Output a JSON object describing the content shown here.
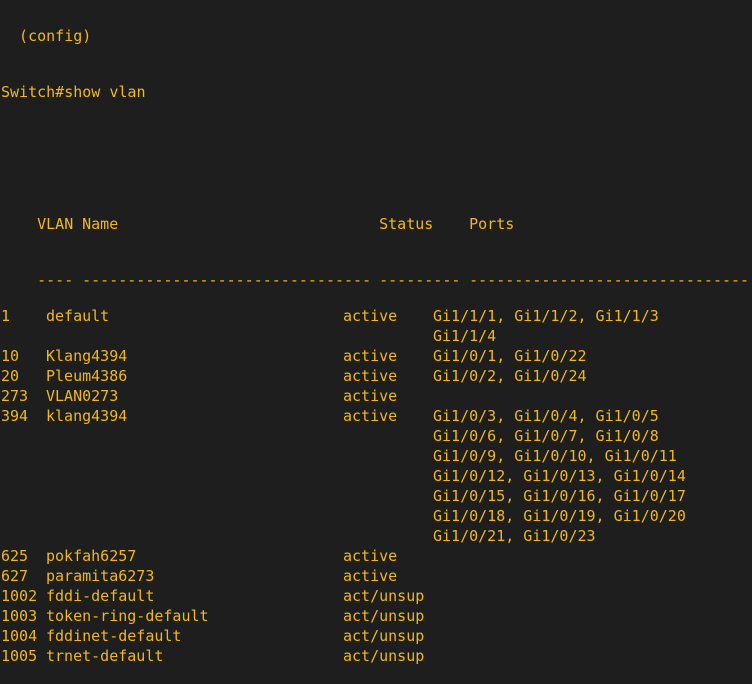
{
  "terminal": {
    "partial_line": "  (config)",
    "command_prompt": "Switch#show vlan"
  },
  "vlan_table": {
    "headers": {
      "vlan": "VLAN",
      "name": "Name",
      "status": "Status",
      "ports": "Ports"
    },
    "separators": {
      "vlan": "----",
      "name": "--------------------------------",
      "status": "---------",
      "ports": "-------------------------------"
    },
    "rows": [
      {
        "vlan": "1",
        "name": "default",
        "status": "active",
        "ports": "Gi1/1/1, Gi1/1/2, Gi1/1/3"
      },
      {
        "vlan": "",
        "name": "",
        "status": "",
        "ports": "Gi1/1/4"
      },
      {
        "vlan": "10",
        "name": "Klang4394",
        "status": "active",
        "ports": "Gi1/0/1, Gi1/0/22"
      },
      {
        "vlan": "20",
        "name": "Pleum4386",
        "status": "active",
        "ports": "Gi1/0/2, Gi1/0/24"
      },
      {
        "vlan": "273",
        "name": "VLAN0273",
        "status": "active",
        "ports": ""
      },
      {
        "vlan": "394",
        "name": "klang4394",
        "status": "active",
        "ports": "Gi1/0/3, Gi1/0/4, Gi1/0/5"
      },
      {
        "vlan": "",
        "name": "",
        "status": "",
        "ports": "Gi1/0/6, Gi1/0/7, Gi1/0/8"
      },
      {
        "vlan": "",
        "name": "",
        "status": "",
        "ports": "Gi1/0/9, Gi1/0/10, Gi1/0/11"
      },
      {
        "vlan": "",
        "name": "",
        "status": "",
        "ports": "Gi1/0/12, Gi1/0/13, Gi1/0/14"
      },
      {
        "vlan": "",
        "name": "",
        "status": "",
        "ports": "Gi1/0/15, Gi1/0/16, Gi1/0/17"
      },
      {
        "vlan": "",
        "name": "",
        "status": "",
        "ports": "Gi1/0/18, Gi1/0/19, Gi1/0/20"
      },
      {
        "vlan": "",
        "name": "",
        "status": "",
        "ports": "Gi1/0/21, Gi1/0/23"
      },
      {
        "vlan": "625",
        "name": "pokfah6257",
        "status": "active",
        "ports": ""
      },
      {
        "vlan": "627",
        "name": "paramita6273",
        "status": "active",
        "ports": ""
      },
      {
        "vlan": "1002",
        "name": "fddi-default",
        "status": "act/unsup",
        "ports": ""
      },
      {
        "vlan": "1003",
        "name": "token-ring-default",
        "status": "act/unsup",
        "ports": ""
      },
      {
        "vlan": "1004",
        "name": "fddinet-default",
        "status": "act/unsup",
        "ports": ""
      },
      {
        "vlan": "1005",
        "name": "trnet-default",
        "status": "act/unsup",
        "ports": ""
      }
    ]
  },
  "colors": {
    "background": "#1e1e1e",
    "text": "#f0b81c"
  }
}
